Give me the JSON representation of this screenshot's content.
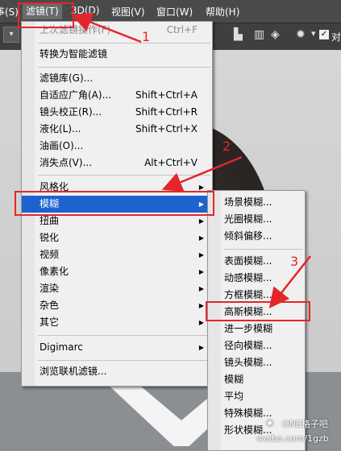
{
  "menubar": {
    "left_fragment": "筝(S)",
    "filter": "滤镜(T)",
    "three_d": "3D(D)",
    "view": "视图(V)",
    "window": "窗口(W)",
    "help": "帮助(H)"
  },
  "toolbar": {
    "right_fragment": "对"
  },
  "filter_menu": {
    "last_filter": {
      "label": "上次滤镜操作(F)",
      "shortcut": "Ctrl+F"
    },
    "convert_smart": "转换为智能滤镜",
    "items_a": [
      {
        "label": "滤镜库(G)...",
        "shortcut": ""
      },
      {
        "label": "自适应广角(A)...",
        "shortcut": "Shift+Ctrl+A"
      },
      {
        "label": "镜头校正(R)...",
        "shortcut": "Shift+Ctrl+R"
      },
      {
        "label": "液化(L)...",
        "shortcut": "Shift+Ctrl+X"
      },
      {
        "label": "油画(O)...",
        "shortcut": ""
      },
      {
        "label": "消失点(V)...",
        "shortcut": "Alt+Ctrl+V"
      }
    ],
    "submenus": [
      "风格化",
      "模糊",
      "扭曲",
      "锐化",
      "视频",
      "像素化",
      "渲染",
      "杂色",
      "其它"
    ],
    "digimarc": "Digimarc",
    "browse_online": "浏览联机滤镜..."
  },
  "blur_submenu": {
    "group1": [
      "场景模糊...",
      "光圈模糊...",
      "倾斜偏移..."
    ],
    "group2": [
      "表面模糊...",
      "动感模糊...",
      "方框模糊...",
      "高斯模糊...",
      "进一步模糊",
      "径向模糊...",
      "镜头模糊...",
      "模糊",
      "平均",
      "特殊模糊...",
      "形状模糊..."
    ]
  },
  "annotations": {
    "step1": "1",
    "step2": "2",
    "step3": "3"
  },
  "watermark": {
    "brand": "ONE格子吧",
    "url": "weibo.com/1gzb"
  },
  "colors": {
    "highlight": "#1d63d0",
    "annotation_red": "#e4262b",
    "menu_bg": "#f0f0f0"
  }
}
